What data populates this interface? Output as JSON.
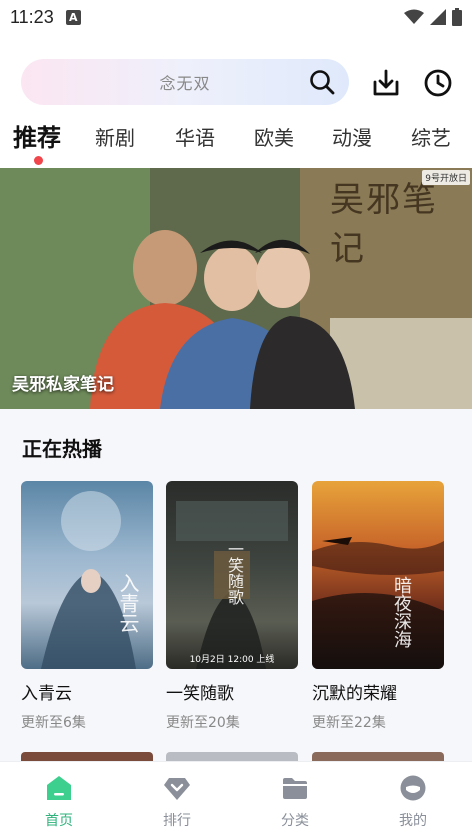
{
  "status_bar": {
    "time": "11:23",
    "badge": "A"
  },
  "search": {
    "placeholder": "念无双"
  },
  "tabs": [
    {
      "label": "推荐",
      "active": true
    },
    {
      "label": "新剧"
    },
    {
      "label": "华语"
    },
    {
      "label": "欧美"
    },
    {
      "label": "动漫"
    },
    {
      "label": "综艺"
    }
  ],
  "banner": {
    "title": "吴邪私家笔记",
    "tag": "9号开放日",
    "calligraphy": "吴邪笔记"
  },
  "section": {
    "title": "正在热播",
    "items": [
      {
        "title": "入青云",
        "subtitle": "更新至6集",
        "poster_text": "入青云"
      },
      {
        "title": "一笑随歌",
        "subtitle": "更新至20集",
        "poster_text": "一笑随歌",
        "date_strip": "10月2日 12:00 上线"
      },
      {
        "title": "沉默的荣耀",
        "subtitle": "更新至22集",
        "poster_text": "暗夜深海"
      }
    ]
  },
  "bottom_nav": [
    {
      "label": "首页",
      "icon": "home-icon",
      "active": true
    },
    {
      "label": "排行",
      "icon": "ranking-icon"
    },
    {
      "label": "分类",
      "icon": "folder-icon"
    },
    {
      "label": "我的",
      "icon": "profile-icon"
    }
  ],
  "colors": {
    "accent": "#2fb37c",
    "dot": "#f0464b"
  }
}
